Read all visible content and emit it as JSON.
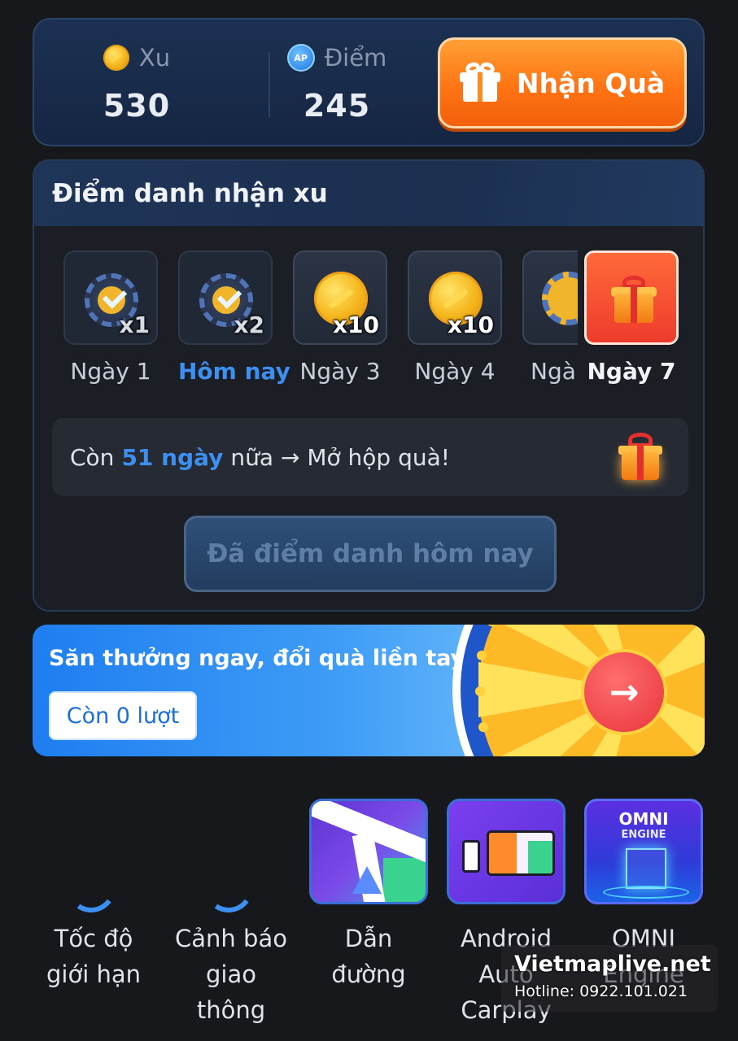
{
  "balance": {
    "xu_label": "Xu",
    "xu_value": "530",
    "diem_label": "Điểm",
    "diem_value": "245",
    "ap_badge": "AP",
    "gift_button_label": "Nhận Quà"
  },
  "checkin": {
    "title": "Điểm danh nhận xu",
    "days": [
      {
        "label": "Ngày 1",
        "multiplier": "x1",
        "state": "claimed"
      },
      {
        "label": "Hôm nay",
        "multiplier": "x2",
        "state": "claimed-today"
      },
      {
        "label": "Ngày 3",
        "multiplier": "x10",
        "state": "upcoming"
      },
      {
        "label": "Ngày 4",
        "multiplier": "x10",
        "state": "upcoming"
      },
      {
        "label": "Ngà",
        "multiplier": "",
        "state": "upcoming-partial"
      },
      {
        "label": "Ngày 7",
        "multiplier": "",
        "state": "gift"
      }
    ],
    "progress_prefix": "Còn",
    "progress_highlight": "51 ngày",
    "progress_suffix": "nữa → Mở hộp quà!",
    "checked_button_label": "Đã điểm danh hôm nay"
  },
  "banner": {
    "title": "Săn thưởng ngay, đổi quà liền tay!",
    "turns_label": "Còn 0 lượt",
    "arrow": "→"
  },
  "features": [
    {
      "name": "Tốc độ giới hạn",
      "icon": "loading-spinner-icon"
    },
    {
      "name": "Cảnh báo giao thông",
      "icon": "loading-spinner-icon"
    },
    {
      "name": "Dẫn đường",
      "icon": "navigation-icon"
    },
    {
      "name": "Android Auto Carplay",
      "icon": "carplay-icon"
    },
    {
      "name": "OMNI Engine",
      "icon": "omni-engine-icon",
      "tile_title": "OMNI",
      "tile_subtitle": "ENGINE"
    }
  ],
  "watermark": {
    "site": "Vietmaplive.net",
    "hotline": "Hotline: 0922.101.021"
  },
  "colors": {
    "accent_blue": "#3d8ff0",
    "orange": "#ff7414",
    "background": "#17181c"
  }
}
